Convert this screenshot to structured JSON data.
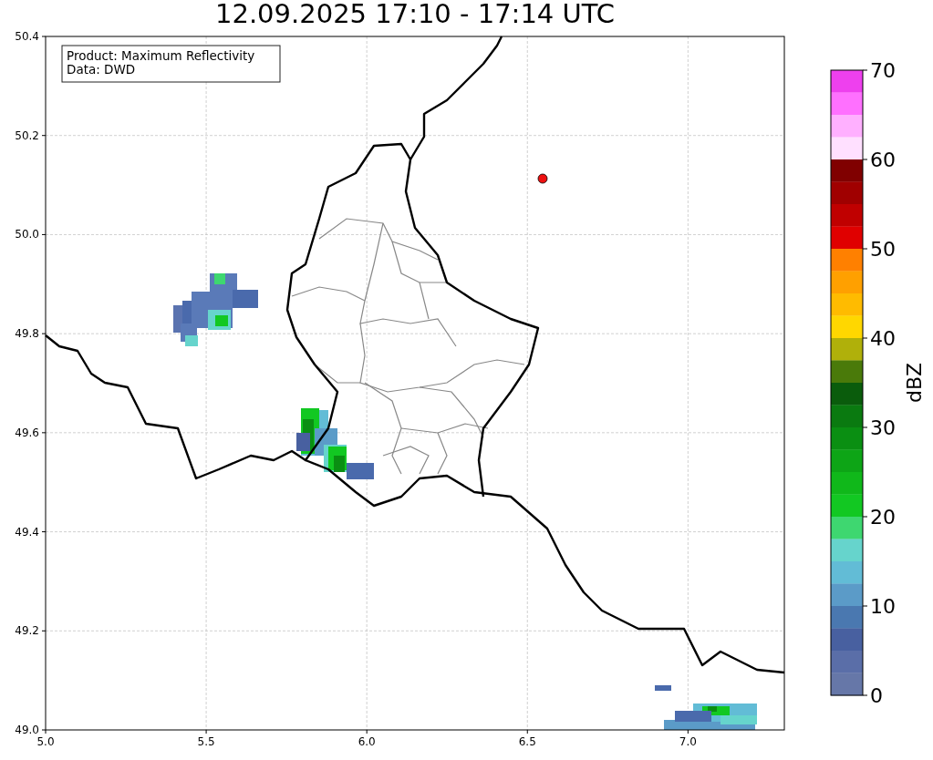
{
  "title": "12.09.2025 17:10 - 17:14 UTC",
  "info_box": {
    "lines": [
      "Product: Maximum Reflectivity",
      "Data: DWD"
    ]
  },
  "x_axis": {
    "ticks": [
      "5.0",
      "5.5",
      "6.0",
      "6.5",
      "7.0"
    ]
  },
  "y_axis": {
    "ticks": [
      "50.4",
      "50.2",
      "50.0",
      "49.8",
      "49.6",
      "49.4",
      "49.2",
      "49.0"
    ]
  },
  "colorbar": {
    "label": "dBZ",
    "ticks": [
      "70",
      "60",
      "50",
      "40",
      "30",
      "20",
      "10",
      "0"
    ],
    "bands": [
      {
        "color": "#ee40ee"
      },
      {
        "color": "#ff70ff"
      },
      {
        "color": "#ffb0ff"
      },
      {
        "color": "#ffe0ff"
      },
      {
        "color": "#800000"
      },
      {
        "color": "#a00000"
      },
      {
        "color": "#c00000"
      },
      {
        "color": "#e00000"
      },
      {
        "color": "#ff8000"
      },
      {
        "color": "#ffa000"
      },
      {
        "color": "#ffbb00"
      },
      {
        "color": "#ffd700"
      },
      {
        "color": "#b0b00a"
      },
      {
        "color": "#4a7a0a"
      },
      {
        "color": "#0a5c0c"
      },
      {
        "color": "#0a7a10"
      },
      {
        "color": "#0a8f12"
      },
      {
        "color": "#0da516"
      },
      {
        "color": "#10b81a"
      },
      {
        "color": "#12c822"
      },
      {
        "color": "#3ed770"
      },
      {
        "color": "#66d4cc"
      },
      {
        "color": "#62bcd6"
      },
      {
        "color": "#5b9bc8"
      },
      {
        "color": "#4a78b0"
      },
      {
        "color": "#4860a0"
      },
      {
        "color": "#5a6ea8"
      },
      {
        "color": "#6677a8"
      }
    ]
  }
}
